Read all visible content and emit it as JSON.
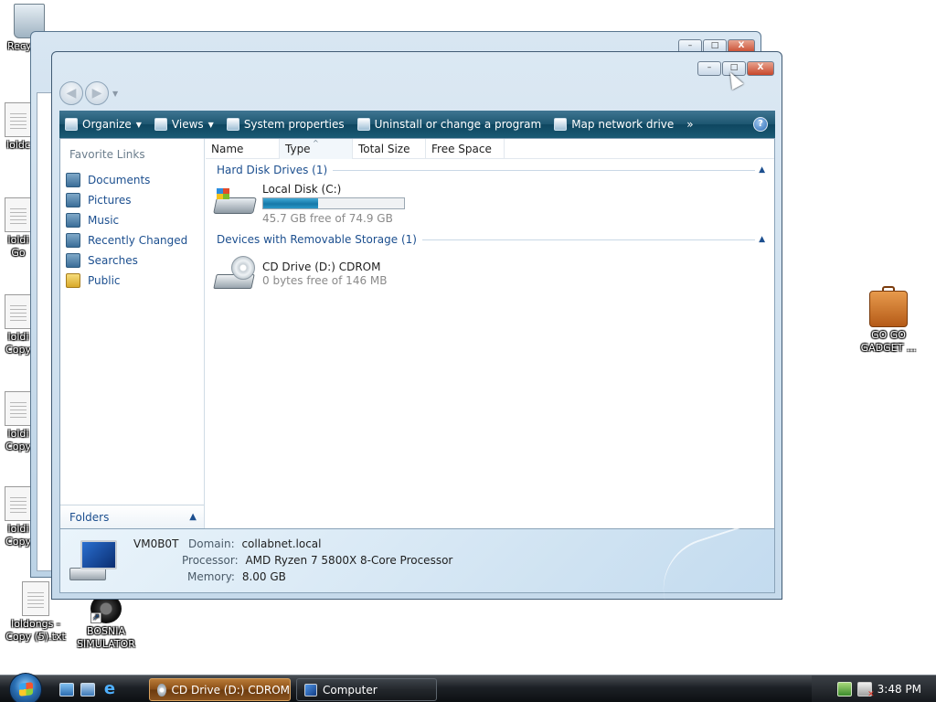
{
  "desktop": {
    "icons": [
      {
        "label": "Recy",
        "type": "recycle-bin"
      },
      {
        "label": "loldc",
        "type": "text-file"
      },
      {
        "label": "loldi Go",
        "type": "text-file"
      },
      {
        "label": "loldi Copy",
        "type": "text-file"
      },
      {
        "label": "loldi Copy",
        "type": "text-file"
      },
      {
        "label": "loldi Copy",
        "type": "text-file"
      },
      {
        "label": "loldongs - Copy (5).txt",
        "type": "text-file"
      },
      {
        "label": "BOSNIA SIMULATOR",
        "type": "shortcut"
      },
      {
        "label": "GO GO GADGET ...",
        "type": "briefcase"
      }
    ]
  },
  "window": {
    "title": "Computer",
    "caption_buttons": {
      "minimize": "–",
      "maximize": "□",
      "close": "X"
    }
  },
  "toolbar": {
    "organize": "Organize",
    "views": "Views",
    "system_properties": "System properties",
    "uninstall": "Uninstall or change a program",
    "map_drive": "Map network drive",
    "more": "»",
    "help": "?"
  },
  "nav": {
    "favorite_links_title": "Favorite Links",
    "links": [
      "Documents",
      "Pictures",
      "Music",
      "Recently Changed",
      "Searches",
      "Public"
    ],
    "folders_label": "Folders"
  },
  "columns": {
    "name": "Name",
    "type": "Type",
    "total_size": "Total Size",
    "free_space": "Free Space"
  },
  "groups": {
    "hdd": {
      "label": "Hard Disk Drives (1)",
      "drive": {
        "name": "Local Disk (C:)",
        "free_text": "45.7 GB free of 74.9 GB",
        "used_fraction": 0.39
      }
    },
    "removable": {
      "label": "Devices with Removable Storage (1)",
      "drive": {
        "name": "CD Drive (D:) CDROM",
        "free_text": "0 bytes free of 146 MB"
      }
    }
  },
  "details": {
    "computer_name": "VM0B0T",
    "domain_label": "Domain:",
    "domain": "collabnet.local",
    "processor_label": "Processor:",
    "processor": "AMD Ryzen 7 5800X 8-Core Processor",
    "memory_label": "Memory:",
    "memory": "8.00 GB"
  },
  "taskbar": {
    "tasks": [
      {
        "label": "CD Drive (D:) CDROM",
        "active": true
      },
      {
        "label": "Computer",
        "active": false
      }
    ],
    "clock": "3:48 PM"
  }
}
